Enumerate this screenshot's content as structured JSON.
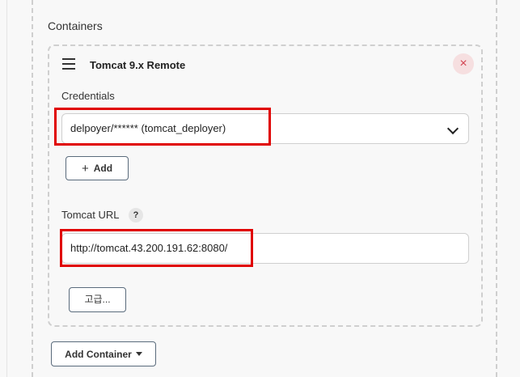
{
  "section": {
    "title": "Containers"
  },
  "container": {
    "title": "Tomcat 9.x Remote",
    "remove_symbol": "×",
    "credentials": {
      "label": "Credentials",
      "selected": "delpoyer/****** (tomcat_deployer)",
      "add_label": "Add",
      "add_icon": "+"
    },
    "tomcat_url": {
      "label": "Tomcat URL",
      "help_symbol": "?",
      "value": "http://tomcat.43.200.191.62:8080/"
    },
    "advanced_label": "고급..."
  },
  "add_container_label": "Add Container",
  "colors": {
    "highlight": "#e00000",
    "remove_bg": "#f6dfe0",
    "remove_fg": "#d24350"
  }
}
